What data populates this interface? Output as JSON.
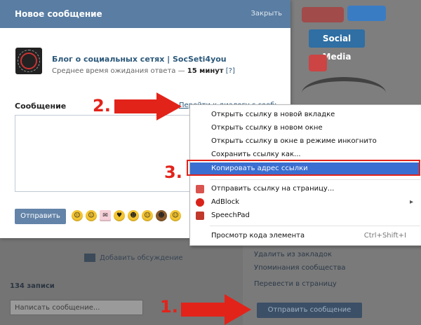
{
  "modal": {
    "title": "Новое сообщение",
    "close_label": "Закрыть",
    "community_name": "Блог о социальных сетях | SocSeti4you",
    "wait_prefix": "Среднее время ожидания ответа —",
    "wait_value": "15 минут",
    "wait_help": "[?]",
    "message_label": "Сообщение",
    "goto_link": "Перейти к диалогу с сообществом",
    "send_label": "Отправить"
  },
  "context_menu": {
    "items": [
      {
        "label": "Открыть ссылку в новой вкладке"
      },
      {
        "label": "Открыть ссылку в новом окне"
      },
      {
        "label": "Открыть ссылку в окне в режиме инкогнито"
      },
      {
        "label": "Сохранить ссылку как..."
      },
      {
        "label": "Копировать адрес ссылки",
        "highlighted": true
      },
      {
        "label": "Отправить ссылку на страницу...",
        "icon": "share-icon"
      },
      {
        "label": "AdBlock",
        "icon": "adblock-icon"
      },
      {
        "label": "SpeechPad",
        "icon": "speechpad-icon"
      },
      {
        "label": "Просмотр кода элемента",
        "shortcut": "Ctrl+Shift+I"
      }
    ]
  },
  "background": {
    "social_sign": "Social Media",
    "discuss_label": "Добавить обсуждение",
    "posts_count": "134 записи",
    "message_placeholder": "Написать сообщение...",
    "side_links": [
      "Удалить из закладок",
      "Упоминания сообщества",
      "Перевести в страницу"
    ],
    "send_message_button": "Отправить сообщение"
  },
  "annotations": {
    "step1": "1.",
    "step2": "2.",
    "step3": "3."
  },
  "colors": {
    "header": "#597da3",
    "highlight": "#3a6ed0",
    "annotation_red": "#e2231a"
  }
}
